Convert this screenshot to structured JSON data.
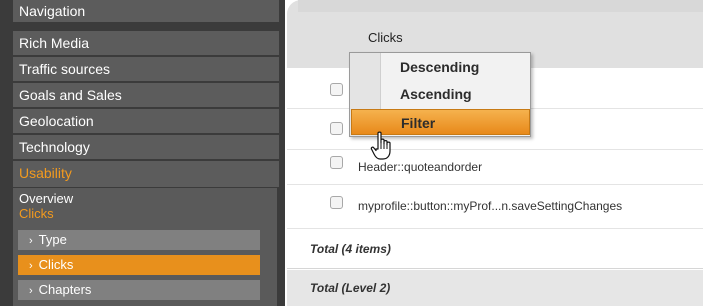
{
  "sidebar": {
    "items": [
      {
        "label": "Navigation"
      },
      {
        "label": "Rich Media"
      },
      {
        "label": "Traffic sources"
      },
      {
        "label": "Goals and Sales"
      },
      {
        "label": "Geolocation"
      },
      {
        "label": "Technology"
      },
      {
        "label": "Usability"
      }
    ],
    "usability": {
      "overview_label": "Overview",
      "current_label": "Clicks",
      "sub_items": [
        {
          "label": "Type"
        },
        {
          "label": "Clicks"
        },
        {
          "label": "Chapters"
        }
      ]
    },
    "chevron": "›",
    "accent_color": "#f39a1e"
  },
  "table": {
    "column_header": "Clicks",
    "rows": [
      {
        "label": ""
      },
      {
        "label": ""
      },
      {
        "label": "Header::quoteandorder"
      },
      {
        "label": "myprofile::button::myProf...n.saveSettingChanges"
      }
    ],
    "total_label": "Total (4 items)",
    "total_level_label": "Total (Level 2)"
  },
  "context_menu": {
    "items": [
      {
        "label": "Descending"
      },
      {
        "label": "Ascending"
      },
      {
        "label": "Filter",
        "highlighted": true
      }
    ]
  },
  "cursor": {
    "icon": "hand-pointer-icon"
  }
}
